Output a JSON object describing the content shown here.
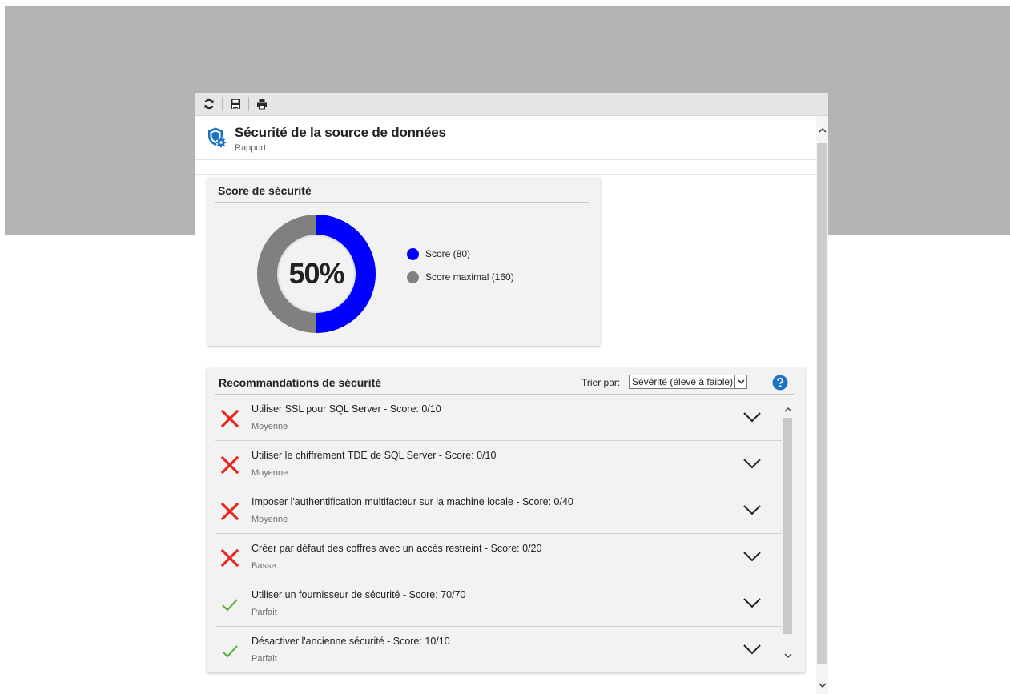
{
  "window": {
    "toolbar": [
      {
        "icon": "refresh-icon",
        "label": "refresh"
      },
      {
        "icon": "save-icon",
        "label": "save"
      },
      {
        "icon": "print-icon",
        "label": "print"
      }
    ],
    "title": "Sécurité de la source de données",
    "subtitle": "Rapport",
    "title_icon": "shield-gear-icon"
  },
  "score_card": {
    "title": "Score de sécurité",
    "center_label": "50%",
    "legend": [
      {
        "label": "Score (80)",
        "color": "#0000ff"
      },
      {
        "label": "Score maximal (160)",
        "color": "#808080"
      }
    ]
  },
  "chart_data": {
    "type": "pie",
    "style": "donut",
    "title": "Score de sécurité",
    "categories": [
      "Score",
      "Score maximal"
    ],
    "values": [
      80,
      160
    ],
    "display_fraction": 0.5,
    "center_label": "50%",
    "colors": [
      "#0000ff",
      "#808080"
    ],
    "legend_placement": "right"
  },
  "recommendations": {
    "title": "Recommandations de sécurité",
    "sort_label": "Trier par:",
    "sort_value": "Sévérité (élevé à faible)",
    "help_icon": "help-icon",
    "items": [
      {
        "name": "Utiliser SSL pour SQL Server - Score: 0/10",
        "severity": "Moyenne",
        "status": "fail"
      },
      {
        "name": "Utiliser le chiffrement TDE de SQL Server - Score: 0/10",
        "severity": "Moyenne",
        "status": "fail"
      },
      {
        "name": "Imposer l'authentification multifacteur sur la machine locale - Score: 0/40",
        "severity": "Moyenne",
        "status": "fail"
      },
      {
        "name": "Créer par défaut des coffres avec un accès restreint - Score: 0/20",
        "severity": "Basse",
        "status": "fail"
      },
      {
        "name": "Utiliser un fournisseur de sécurité - Score: 70/70",
        "severity": "Parfait",
        "status": "pass"
      },
      {
        "name": "Désactiver l'ancienne sécurité - Score: 10/10",
        "severity": "Parfait",
        "status": "pass"
      }
    ]
  },
  "colors": {
    "fail": "#e8261f",
    "pass": "#4caf2f",
    "accent": "#0b6fc4",
    "backdrop": "#b4b4b4"
  }
}
